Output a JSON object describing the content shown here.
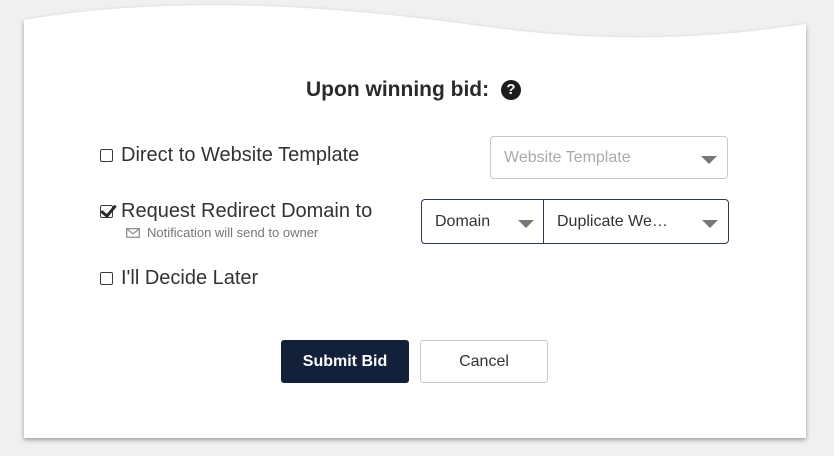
{
  "dialog": {
    "title": "Upon winning bid:",
    "help_icon": "?"
  },
  "options": [
    {
      "label": "Direct to Website Template",
      "checked": false
    },
    {
      "label": "Request Redirect Domain to",
      "checked": true,
      "note": "Notification will send to owner"
    },
    {
      "label": "I'll Decide Later",
      "checked": false
    }
  ],
  "selects": {
    "website_template": {
      "placeholder": "Website Template"
    },
    "domain": {
      "value": "Domain"
    },
    "duplicate": {
      "value": "Duplicate We…"
    }
  },
  "buttons": {
    "submit": "Submit Bid",
    "cancel": "Cancel"
  },
  "colors": {
    "primary": "#12203a",
    "background": "#f0f0f0"
  }
}
